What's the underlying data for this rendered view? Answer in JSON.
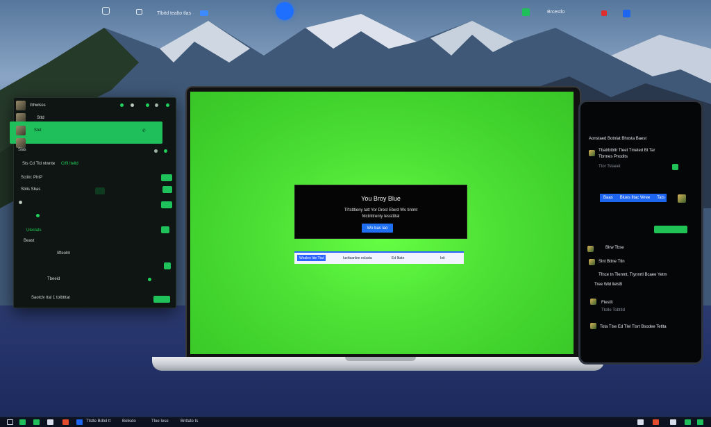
{
  "top_bar": {
    "left_icon": "settings-icon",
    "center_label": "Tlbitd tealto tlas",
    "right_app_label": "Brcestlo"
  },
  "left_window": {
    "rows": [
      {
        "label": "Ghwisss"
      },
      {
        "label": "Sttd"
      },
      {
        "label": "Stet"
      },
      {
        "label": "Slas"
      }
    ],
    "section_a": "Sts Cd Tld ntwnte",
    "section_a_btn": "Ctfil Itelld",
    "row_b": "Sctiln: PhtP",
    "row_c": "Sblis Sbas",
    "row_d": "Uteclats",
    "row_e": "Beast",
    "row_f": "Iifteolm",
    "row_g": "Tbeeid",
    "footer": "Saotclv ttal 1 tolbtttat"
  },
  "laptop": {
    "dialog_title": "You Broy Blue",
    "dialog_line1": "Tl'tstttieny tatt Yor Drecl Eterd Ws tintmt",
    "dialog_line2": "Mctnttrenty Iessttttal",
    "dialog_button": "Wo bas lao",
    "strip_items": [
      "Wealeo Ide Ttat",
      "Iuettsanlee eclasta",
      "Ed Iltate",
      "Ioit"
    ]
  },
  "tablet": {
    "header": "Aonstaed Botnlat Bhosta Baest",
    "line1": "Tbatrbtbltr Tleet Tmeted Bt Tar",
    "line2": "Tbrmes Pnodits",
    "line3": "Ttor Tstaeet",
    "blue_labels": [
      "Baas",
      "Blues Iltac Wree",
      "Tats"
    ],
    "list": [
      "Blrw Tbse",
      "Slnt Bttne Ttln",
      "Tfnce tn Tlenmt, Ttynnrtl Bcaee Yetm",
      "Tree Wld llelsB",
      "Ftestlt",
      "Ttolle Tobttld",
      "Tota Tlse Ed Tlel Tlsrt Bsodee Tetlta"
    ]
  },
  "taskbar": {
    "items": [
      "Ttstte Bdtol tt",
      "Bolisdo",
      "Tloe Iese",
      "Bnttate ts"
    ]
  },
  "colors": {
    "accent_green": "#1fc25a",
    "screen_green": "#4ee236",
    "accent_blue": "#1e66f0"
  }
}
